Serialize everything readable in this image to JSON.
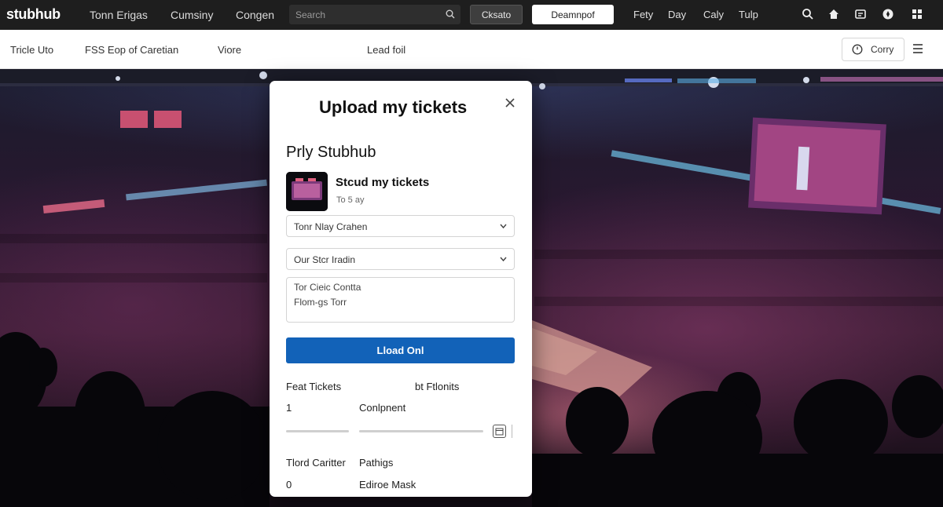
{
  "topnav": {
    "logo": "stubhub",
    "links": [
      "Tonn Erigas",
      "Cumsiny",
      "Congen"
    ],
    "search_placeholder": "Search",
    "btn_dark": "Cksato",
    "btn_light": "Deamnpof",
    "right_links": [
      "Fety",
      "Day",
      "Caly",
      "Tulp"
    ],
    "icons": [
      "search-icon",
      "home-icon",
      "inbox-icon",
      "compass-icon",
      "grid-icon"
    ]
  },
  "subnav": {
    "links": [
      "Tricle Uto",
      "FSS Eop of Caretian",
      "Viore",
      "Lead foil"
    ],
    "button_label": "Corry"
  },
  "modal": {
    "title": "Upload my tickets",
    "subtitle": "Prly Stubhub",
    "ticket_name": "Stcud my tickets",
    "ticket_meta": "To 5 ay",
    "select_1": "Tonr Nlay Crahen",
    "select_2": "Our Stcr Iradin",
    "textarea_line_1": "Tor Cieic Contta",
    "textarea_line_2": "Flom-gs Torr",
    "primary_button": "Lload Onl",
    "labels": {
      "feat_tickets": "Feat Tickets",
      "bt_ftlonits": "bt Ftlonits",
      "qty": "1",
      "conlpnent": "Conlpnent",
      "tlord_caritter": "Tlord Caritter",
      "pathigs": "Pathigs",
      "zero": "0",
      "ediroe_mask": "Ediroe Mask"
    }
  },
  "colors": {
    "topnav_bg": "#1e1e1e",
    "primary_blue": "#1262b8",
    "modal_bg": "#ffffff"
  }
}
